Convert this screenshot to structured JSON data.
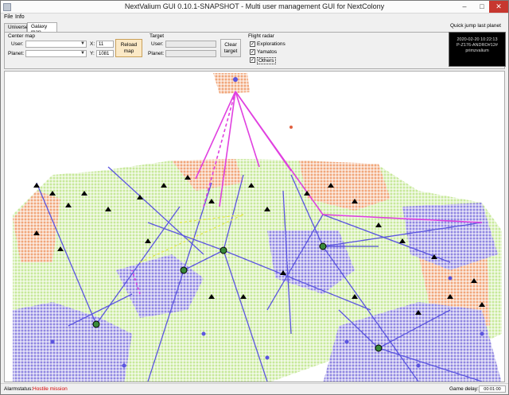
{
  "window": {
    "title": "NextValium GUI 0.10.1-SNAPSHOT - Multi user management GUI for NextColony"
  },
  "menu": [
    "File",
    "Info"
  ],
  "tabs": [
    {
      "label": "Universe",
      "active": false
    },
    {
      "label": "Galaxy map",
      "active": true
    }
  ],
  "center_map": {
    "title": "Center map",
    "user_label": "User:",
    "user_value": "",
    "planet_label": "Planet:",
    "planet_value": "",
    "x_label": "X:",
    "x_value": "11",
    "y_label": "Y:",
    "y_value": "1081",
    "reload_button": "Reload map"
  },
  "target": {
    "title": "Target",
    "user_label": "User:",
    "user_value": "",
    "planet_label": "Planet:",
    "planet_value": "",
    "clear_button": "Clear target"
  },
  "flight_radar": {
    "title": "Flight radar",
    "options": [
      {
        "label": "Explorations",
        "checked": true
      },
      {
        "label": "Yamatos",
        "checked": true
      },
      {
        "label": "Others",
        "checked": true
      }
    ]
  },
  "quick_jump": {
    "title": "Quick jump last planet",
    "lines": [
      "2020-02-20 10:22:13",
      "P-Z176-ANDRO#12#",
      "primzvalium"
    ]
  },
  "status": {
    "alarm_label": "Alarmstatus:",
    "alarm_value": "Hostile mission",
    "alarm_color": "#d40000",
    "delay_label": "Game delay:",
    "delay_value": "00:01:00"
  },
  "map_colors": {
    "green_territory": "#c7e89a",
    "purple_territory": "#8f86e0",
    "orange_territory": "#f0a67a",
    "flight_lines": "#5b55e0",
    "yamato_lines": "#e040e0",
    "fleet_markers": "#000000"
  }
}
